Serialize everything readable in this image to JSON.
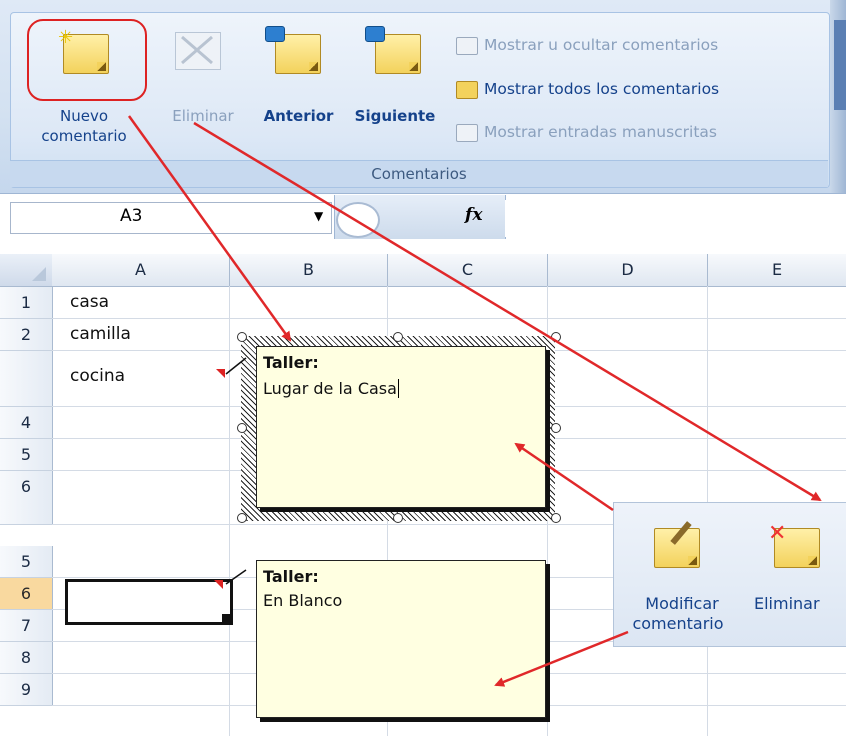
{
  "ribbon": {
    "buttons": {
      "nuevo_line1": "Nuevo",
      "nuevo_line2": "comentario",
      "eliminar": "Eliminar",
      "anterior": "Anterior",
      "siguiente": "Siguiente"
    },
    "options": {
      "mostrar_ocultar": "Mostrar u ocultar comentarios",
      "mostrar_todos": "Mostrar todos los comentarios",
      "mostrar_entradas": "Mostrar entradas manuscritas"
    },
    "group_caption": "Comentarios"
  },
  "formula_bar": {
    "name_box": "A3",
    "fx": "fx",
    "formula": ""
  },
  "grid": {
    "columns": [
      "A",
      "B",
      "C",
      "D",
      "E"
    ],
    "rows_top": [
      "1",
      "2",
      "",
      "4",
      "5",
      "6"
    ],
    "rows_bottom": [
      "5",
      "6",
      "7",
      "8",
      "9"
    ],
    "cells": {
      "a1": "casa",
      "a2": "camilla",
      "a3": "cocina"
    }
  },
  "comments": {
    "first": {
      "author": "Taller:",
      "text": "Lugar de la Casa"
    },
    "second": {
      "author": "Taller:",
      "text": "En Blanco"
    }
  },
  "popup": {
    "modificar_line1": "Modificar",
    "modificar_line2": "comentario",
    "eliminar": "Eliminar"
  },
  "colors": {
    "annotation_arrow": "#e0282a",
    "ribbon_text": "#15428b",
    "active_row_header": "#f9d99f",
    "comment_fill": "#ffffe1"
  }
}
